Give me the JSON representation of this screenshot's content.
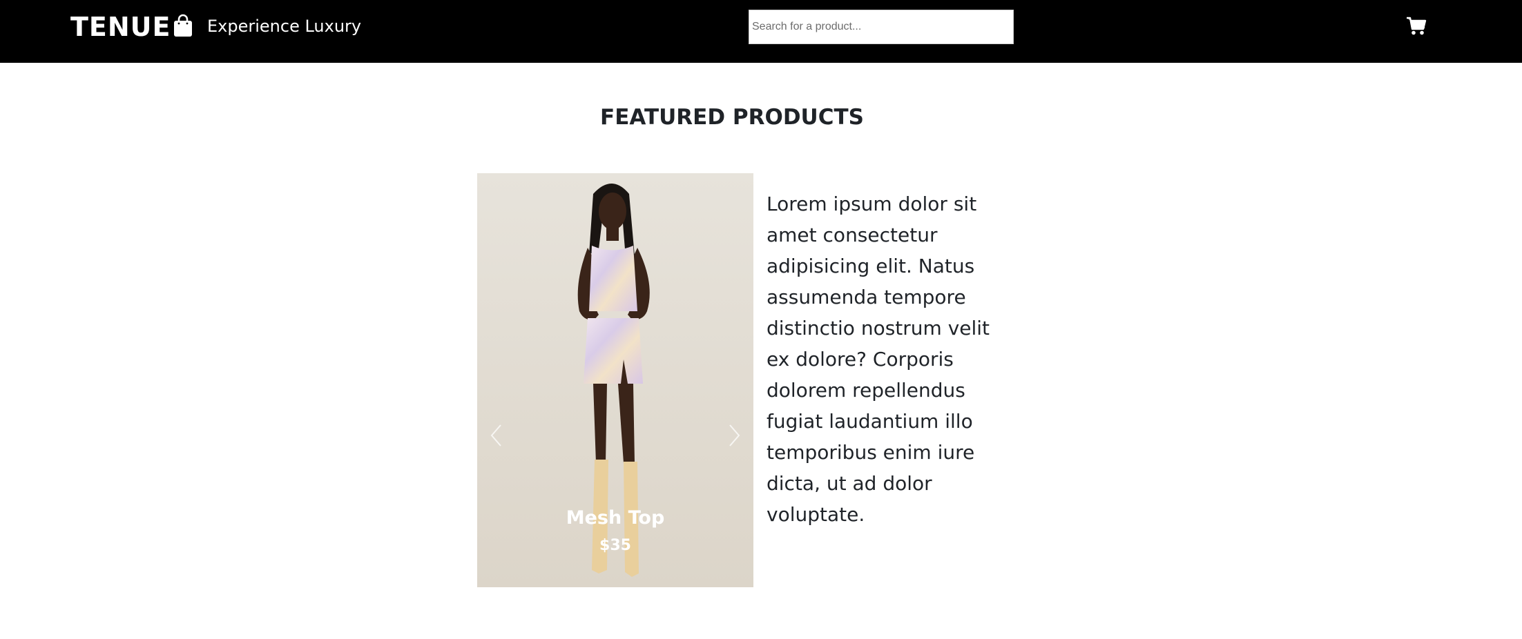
{
  "header": {
    "brand": "TENUE",
    "brand_icon": "shopping-bag-icon",
    "tagline": "Experience Luxury",
    "search": {
      "placeholder": "Search for a product...",
      "value": ""
    },
    "cart_icon": "shopping-cart-icon",
    "background": "#000000",
    "text_color": "#ffffff"
  },
  "featured": {
    "title": "FEATURED PRODUCTS",
    "carousel": {
      "prev_icon": "chevron-left-icon",
      "next_icon": "chevron-right-icon",
      "active_item": {
        "name": "Mesh Top",
        "price": "$35"
      }
    },
    "description": "Lorem ipsum dolor sit amet consectetur adipisicing elit. Natus assumenda tempore distinctio nostrum velit ex dolore? Corporis dolorem repellendus fugiat laudantium illo temporibus enim iure dicta, ut ad dolor voluptate."
  }
}
